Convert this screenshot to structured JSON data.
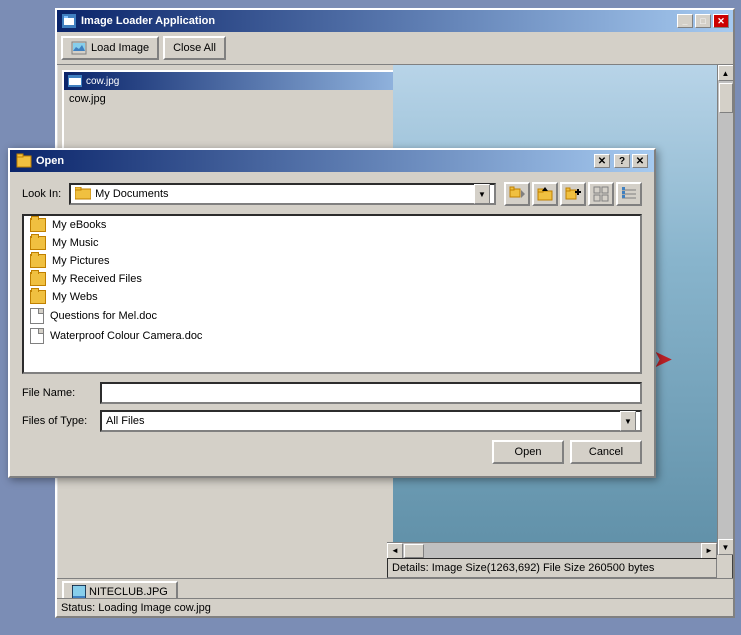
{
  "app": {
    "title": "Image Loader Application",
    "toolbar": {
      "load_image": "Load Image",
      "close_all": "Close All"
    }
  },
  "mdi_child": {
    "title": "cow.jpg",
    "filename": "cow.jpg"
  },
  "dialog": {
    "title": "Open",
    "look_in_label": "Look In:",
    "look_in_value": "My Documents",
    "files": [
      {
        "name": "My eBooks",
        "type": "folder"
      },
      {
        "name": "My Music",
        "type": "folder"
      },
      {
        "name": "My Pictures",
        "type": "folder"
      },
      {
        "name": "My Received Files",
        "type": "folder"
      },
      {
        "name": "My Webs",
        "type": "folder"
      },
      {
        "name": "Questions for Mel.doc",
        "type": "doc"
      },
      {
        "name": "Waterproof Colour Camera.doc",
        "type": "doc"
      }
    ],
    "file_name_label": "File Name:",
    "file_name_value": "",
    "files_of_type_label": "Files of Type:",
    "files_of_type_value": "All Files",
    "open_button": "Open",
    "cancel_button": "Cancel"
  },
  "details_bar": {
    "text": "Details: Image Size(1263,692) File Size 260500 bytes"
  },
  "bottom": {
    "thumbnail_label": "NITECLUB.JPG",
    "status": "Status: Loading Image cow.jpg"
  }
}
